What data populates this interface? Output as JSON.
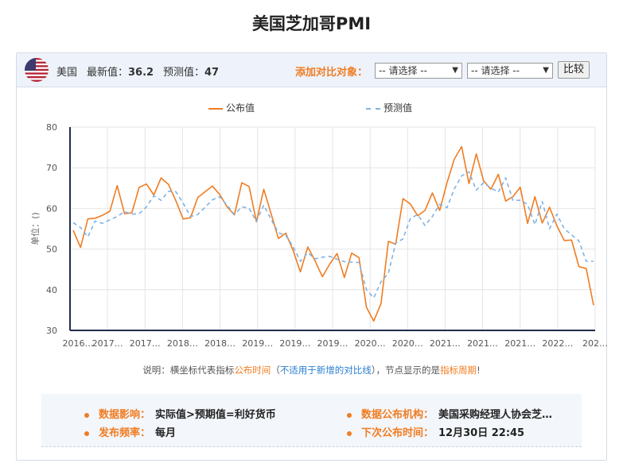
{
  "page": {
    "title": "美国芝加哥PMI"
  },
  "topbar": {
    "country": "美国",
    "latest_label": "最新值：",
    "latest_value": "36.2",
    "forecast_label": "预测值：",
    "forecast_value": "47",
    "compare_label": "添加对比对象：",
    "select1": "-- 请选择 --",
    "select2": "-- 请选择 --",
    "compare_button": "比较"
  },
  "legend": {
    "actual": "公布值",
    "forecast": "预测值"
  },
  "note": {
    "p1": "说明：横坐标代表指标",
    "p2": "公布时间",
    "p3": "（",
    "p4": "不适用于新增的对比线",
    "p5": "），节点显示的是",
    "p6": "指标周期",
    "p7": "!"
  },
  "info": {
    "impact_label": "数据影响：",
    "impact_value": "实际值>预期值=利好货币",
    "org_label": "数据公布机构：",
    "org_value": "美国采购经理人协会芝…",
    "freq_label": "发布频率：",
    "freq_value": "每月",
    "next_label": "下次公布时间：",
    "next_value": "12月30日 22:45"
  },
  "colors": {
    "actual": "#f07c21",
    "forecast": "#7fb3e6",
    "accent": "#f07c21"
  },
  "chart_data": {
    "type": "line",
    "ylabel": "单位：()",
    "ylim": [
      30,
      80
    ],
    "yticks": [
      30,
      40,
      50,
      60,
      70,
      80
    ],
    "xtick_labels": [
      "2016…",
      "2017…",
      "2017…",
      "2018…",
      "2018…",
      "2019…",
      "2019…",
      "2019…",
      "2020…",
      "2020…",
      "2021…",
      "2021…",
      "2021…",
      "2022…",
      "202…"
    ],
    "series": [
      {
        "name": "公布值",
        "style": "solid",
        "values": [
          54.6,
          50.4,
          57.4,
          57.6,
          58.3,
          59.3,
          65.6,
          58.7,
          58.9,
          65.2,
          66.0,
          63.3,
          67.5,
          65.9,
          61.9,
          57.4,
          57.7,
          62.7,
          64.1,
          65.5,
          63.4,
          60.4,
          58.4,
          66.3,
          65.4,
          56.7,
          64.7,
          58.7,
          52.6,
          53.9,
          49.7,
          44.4,
          50.5,
          47.1,
          43.2,
          46.3,
          48.9,
          43.0,
          49.0,
          47.9,
          35.7,
          32.3,
          36.6,
          51.9,
          51.2,
          62.4,
          61.1,
          58.2,
          59.5,
          63.8,
          59.5,
          66.3,
          72.1,
          75.2,
          66.1,
          73.4,
          66.8,
          64.7,
          68.4,
          61.8,
          62.9,
          65.2,
          56.3,
          62.9,
          56.4,
          60.3,
          55.7,
          52.1,
          52.2,
          45.7,
          45.2,
          36.2
        ]
      },
      {
        "name": "预测值",
        "style": "dashed",
        "values": [
          56.5,
          55.3,
          53.0,
          56.9,
          56.3,
          57.2,
          58.0,
          59.2,
          58.6,
          58.7,
          60.4,
          63.1,
          62.0,
          64.2,
          64.1,
          61.3,
          58.0,
          58.5,
          60.3,
          62.1,
          62.9,
          60.8,
          58.5,
          60.4,
          60.0,
          56.8,
          60.8,
          57.3,
          54.0,
          53.4,
          50.6,
          47.0,
          49.1,
          47.6,
          48.0,
          48.2,
          47.5,
          46.9,
          46.8,
          46.7,
          40.0,
          38.0,
          42.0,
          44.0,
          51.5,
          52.5,
          57.5,
          58.5,
          55.8,
          58.0,
          61.0,
          60.2,
          64.8,
          68.0,
          69.0,
          64.5,
          66.3,
          65.0,
          64.0,
          67.5,
          62.0,
          62.0,
          61.0,
          56.0,
          61.7,
          55.0,
          58.6,
          55.0,
          53.5,
          52.0,
          47.0,
          47.0
        ]
      }
    ]
  }
}
